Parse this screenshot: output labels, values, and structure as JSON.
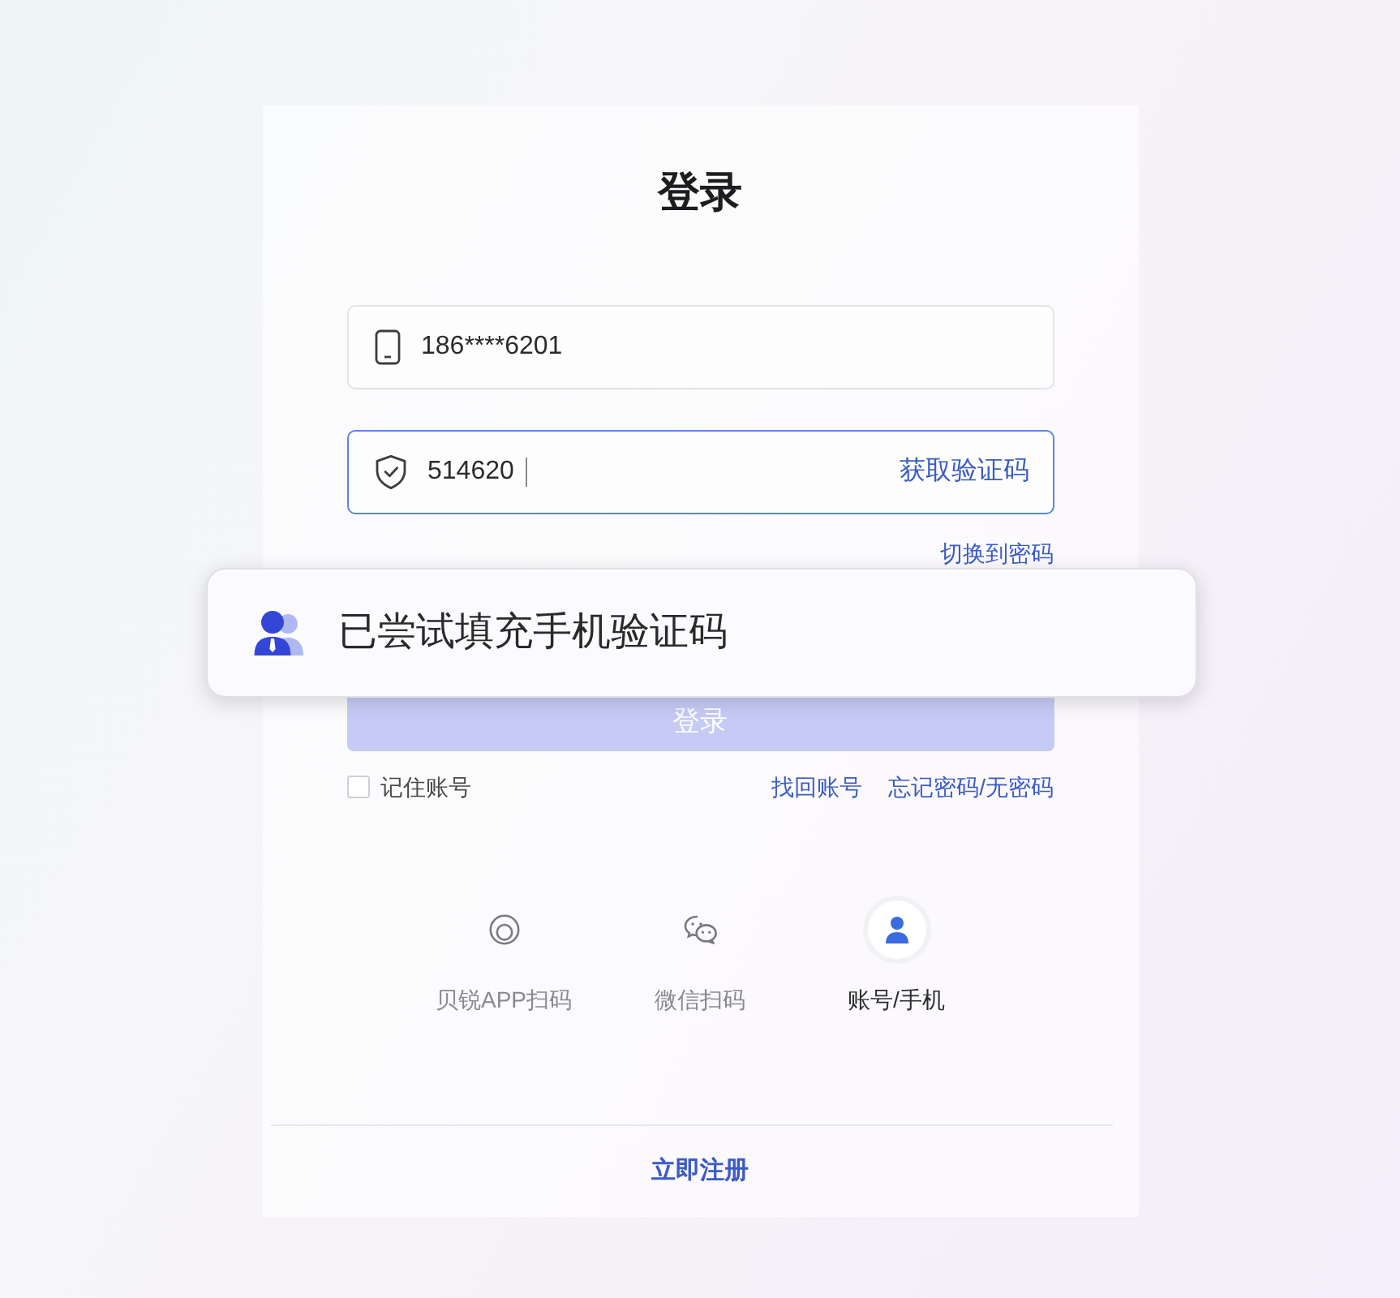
{
  "title": "登录",
  "fields": [
    {
      "kind": "phone",
      "value": "186****6201",
      "focused": false
    },
    {
      "kind": "code",
      "value": "514620",
      "focused": true,
      "action": "获取验证码"
    }
  ],
  "switch_link": "切换到密码",
  "toast": {
    "message": "已尝试填充手机验证码"
  },
  "login_button": {
    "label": "登录",
    "disabled": true
  },
  "remember": {
    "label": "记住账号",
    "checked": false
  },
  "help_links": [
    "找回账号",
    "忘记密码/无密码"
  ],
  "login_methods": [
    {
      "kind": "app_scan",
      "label": "贝锐APP扫码",
      "selected": false
    },
    {
      "kind": "chat_scan",
      "label": "微信扫码",
      "selected": false
    },
    {
      "kind": "account",
      "label": "账号/手机",
      "selected": true
    }
  ],
  "register_link": "立即注册"
}
